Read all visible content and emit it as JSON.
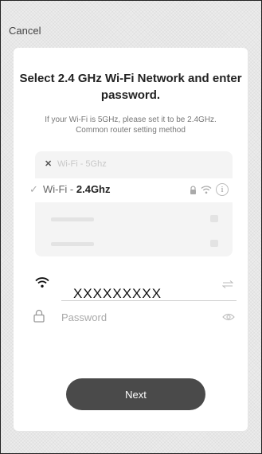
{
  "header": {
    "cancel_label": "Cancel"
  },
  "dialog": {
    "title": "Select 2.4 GHz Wi-Fi Network and enter password.",
    "subtitle": "If your Wi-Fi is 5GHz, please set it to be 2.4GHz. Common router setting method"
  },
  "networks": [
    {
      "label": "Wi-Fi - 5Ghz",
      "status": "unsupported"
    },
    {
      "prefix": "Wi-Fi - ",
      "band": "2.4Ghz",
      "selected": true,
      "icons": [
        "lock-icon",
        "wifi-icon",
        "info-icon"
      ]
    }
  ],
  "form": {
    "ssid_value": "XXXXXXXXX",
    "password_placeholder": "Password"
  },
  "actions": {
    "next_label": "Next"
  },
  "colors": {
    "button": "#4a4a4a",
    "card": "#ffffff",
    "background": "#ececec"
  }
}
